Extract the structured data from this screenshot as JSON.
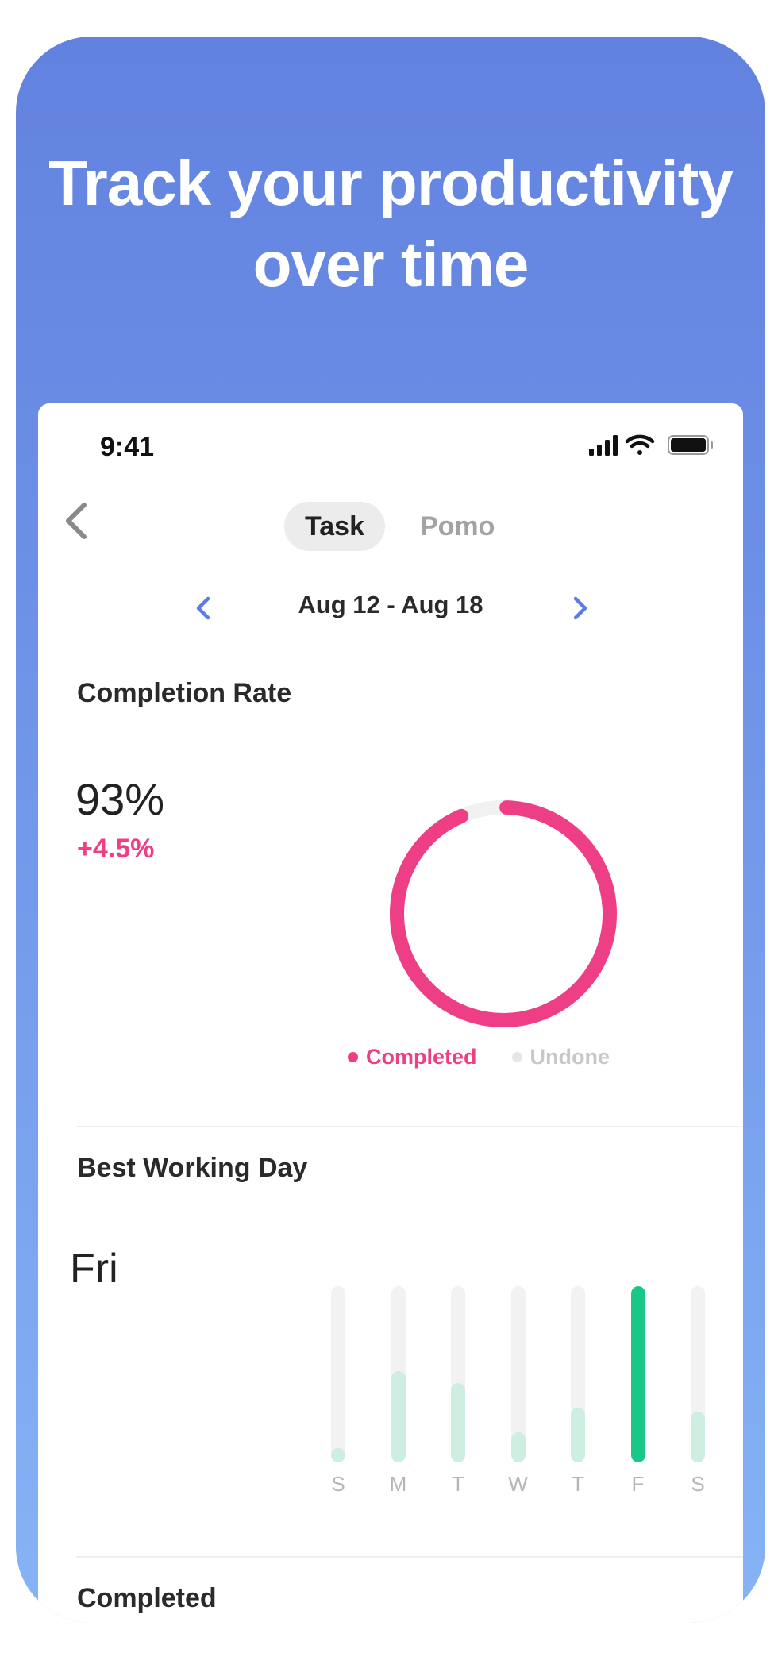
{
  "headline": {
    "line1": "Track your productivity",
    "line2": "over time"
  },
  "status_bar": {
    "time": "9:41",
    "icons": [
      "signal-icon",
      "wifi-icon",
      "battery-icon"
    ]
  },
  "nav": {
    "back_icon": "chevron-left-icon",
    "tabs": [
      {
        "label": "Task",
        "active": true
      },
      {
        "label": "Pomo",
        "active": false
      }
    ]
  },
  "date_range": {
    "label": "Aug 12 - Aug 18",
    "prev_icon": "chevron-left-icon",
    "next_icon": "chevron-right-icon"
  },
  "completion_rate": {
    "title": "Completion Rate",
    "value": "93%",
    "delta": "+4.5%",
    "completed_fraction": 0.93,
    "legend": [
      {
        "label": "Completed",
        "color": "#ee3f86"
      },
      {
        "label": "Undone",
        "color": "#e6e6e6"
      }
    ]
  },
  "best_working_day": {
    "title": "Best Working Day",
    "value": "Fri",
    "days": [
      {
        "label": "S",
        "level": 0.08,
        "best": false
      },
      {
        "label": "M",
        "level": 0.52,
        "best": false
      },
      {
        "label": "T",
        "level": 0.45,
        "best": false
      },
      {
        "label": "W",
        "level": 0.17,
        "best": false
      },
      {
        "label": "T",
        "level": 0.31,
        "best": false
      },
      {
        "label": "F",
        "level": 1.0,
        "best": true
      },
      {
        "label": "S",
        "level": 0.29,
        "best": false
      }
    ]
  },
  "completed_section": {
    "title": "Completed"
  },
  "colors": {
    "accent_blue": "#5b7ce0",
    "pink": "#ee3f86",
    "green": "#19c787",
    "light_green": "#cdeee0"
  }
}
